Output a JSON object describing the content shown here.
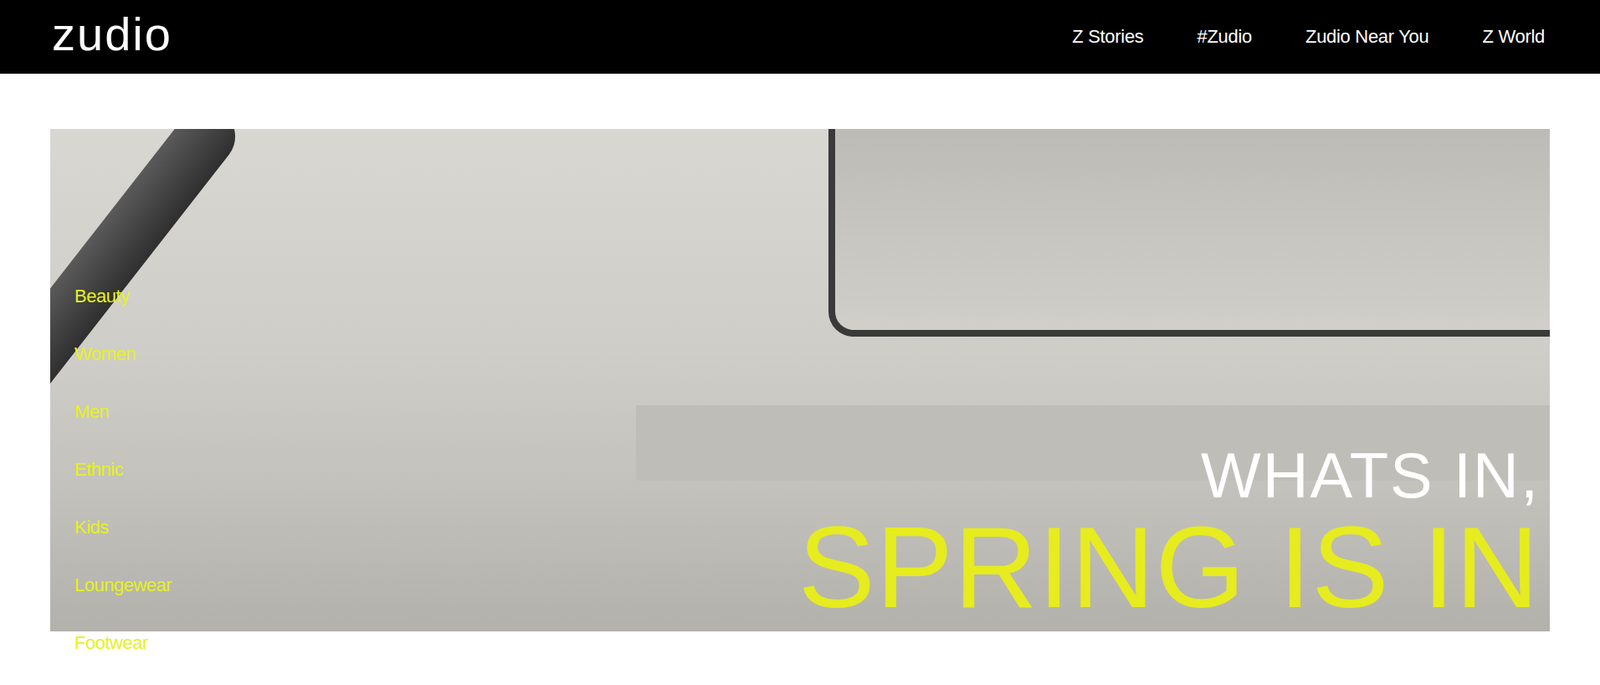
{
  "header": {
    "logo": "zudio",
    "nav": [
      "Z Stories",
      "#Zudio",
      "Zudio Near You",
      "Z World"
    ]
  },
  "hero": {
    "categories": [
      "Beauty",
      "Women",
      "Men",
      "Ethnic",
      "Kids",
      "Loungewear",
      "Footwear"
    ],
    "headline_top": "WHATS IN,",
    "headline_bottom": "SPRING IS IN"
  }
}
